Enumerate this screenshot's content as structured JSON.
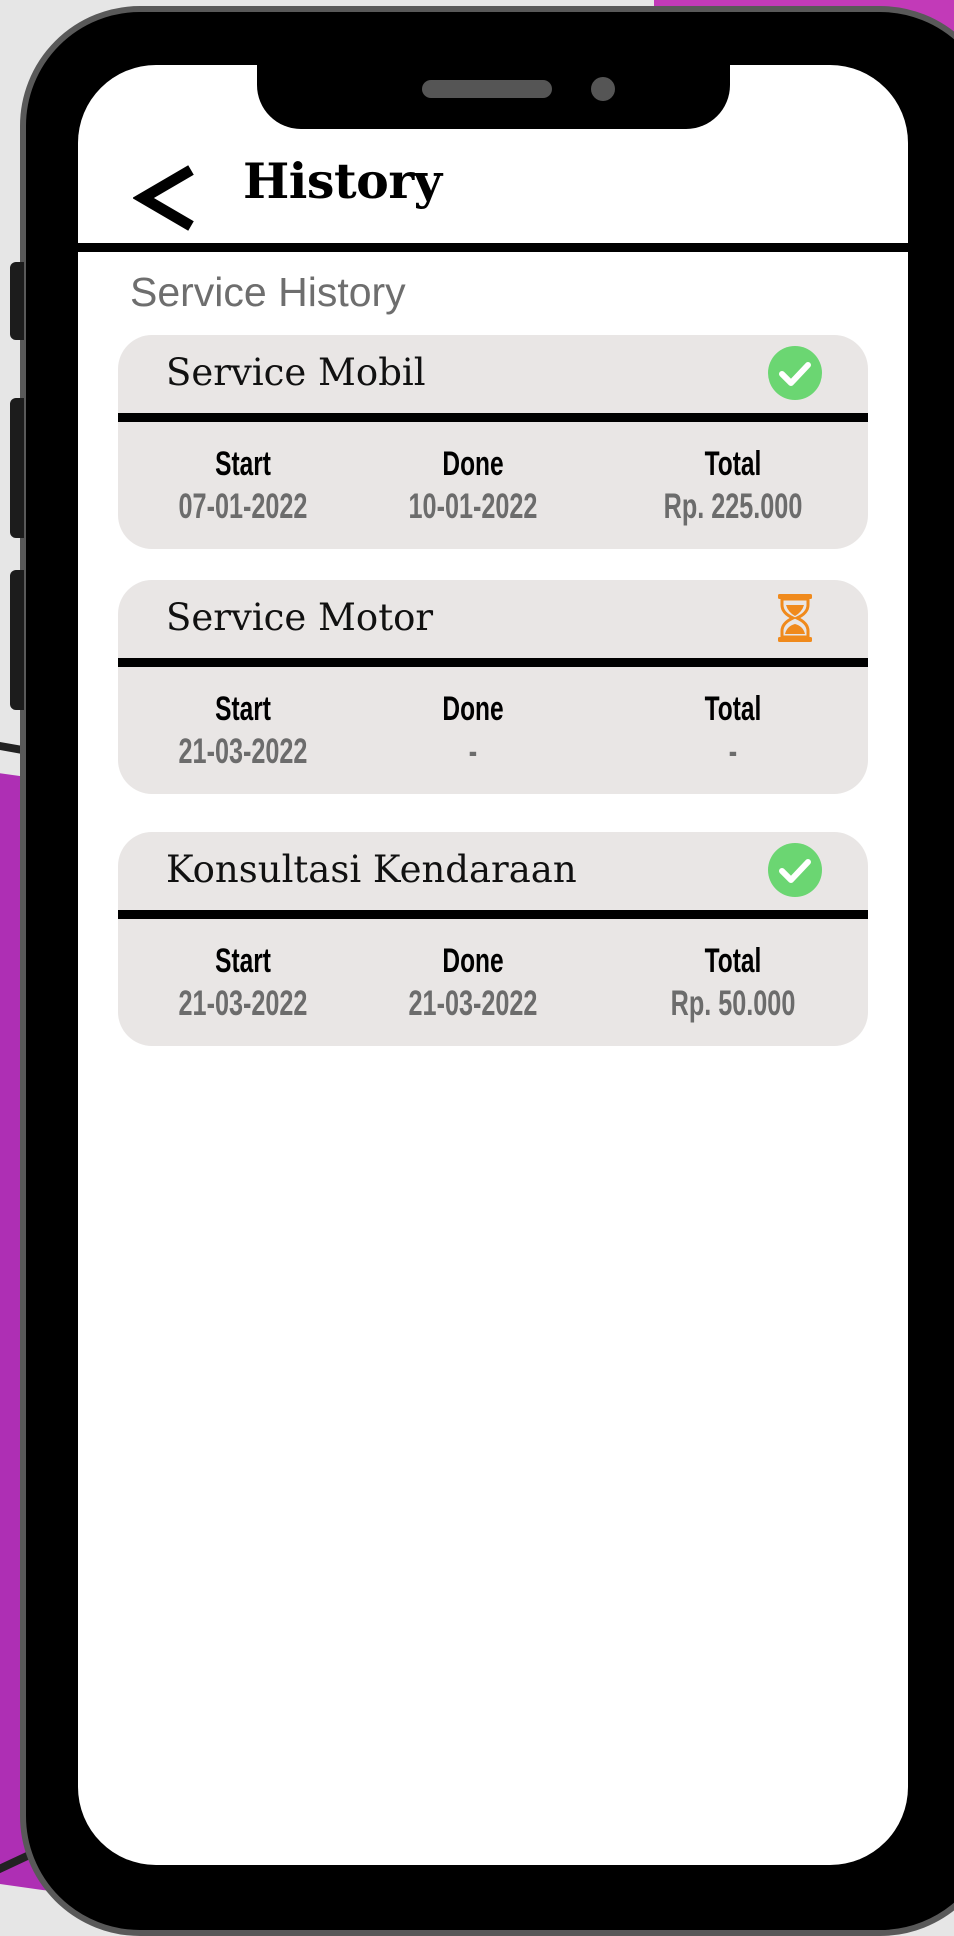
{
  "header": {
    "title": "History"
  },
  "section": {
    "title": "Service History"
  },
  "columns": {
    "start": "Start",
    "done": "Done",
    "total": "Total"
  },
  "colors": {
    "accent_bg": "#c23ab8",
    "card_bg": "#e9e6e5",
    "done_green": "#6bd672",
    "pending_orange": "#f08a1c"
  },
  "cards": [
    {
      "name": "Service Mobil",
      "status": "done",
      "status_icon": "check-circle-icon",
      "start": "07-01-2022",
      "done": "10-01-2022",
      "total": "Rp. 225.000"
    },
    {
      "name": "Service Motor",
      "status": "pending",
      "status_icon": "hourglass-icon",
      "start": "21-03-2022",
      "done": "-",
      "total": "-"
    },
    {
      "name": "Konsultasi Kendaraan",
      "status": "done",
      "status_icon": "check-circle-icon",
      "start": "21-03-2022",
      "done": "21-03-2022",
      "total": "Rp. 50.000"
    }
  ]
}
